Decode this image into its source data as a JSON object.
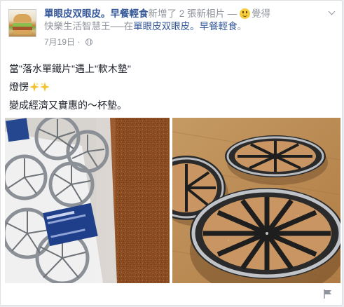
{
  "post": {
    "page_name": "單眼皮双眼皮。早餐輕食",
    "action_text": "新增了 2 張新相片 — ",
    "feeling_emoji": "smiley-emoji",
    "feeling_text": "覺得",
    "feeling_line2": "快樂生活智慧王──在",
    "feeling_page": "單眼皮双眼皮。早餐輕食",
    "feeling_end": "。",
    "date": "7月19日",
    "privacy_icon": "globe-icon",
    "menu_icon": "chevron-down-icon"
  },
  "content": {
    "line1": "當\"落水單鐵片\"遇上\"軟木墊\"",
    "line2": "燈愣",
    "line2_icons": [
      "sparkle-icon",
      "sparkle-icon"
    ],
    "line3": "變成經濟又實惠的～杯墊。"
  },
  "photos": [
    {
      "name": "photo-packaged-coasters"
    },
    {
      "name": "photo-cork-coasters"
    }
  ],
  "footer": {
    "report_icon": "flag-icon"
  }
}
